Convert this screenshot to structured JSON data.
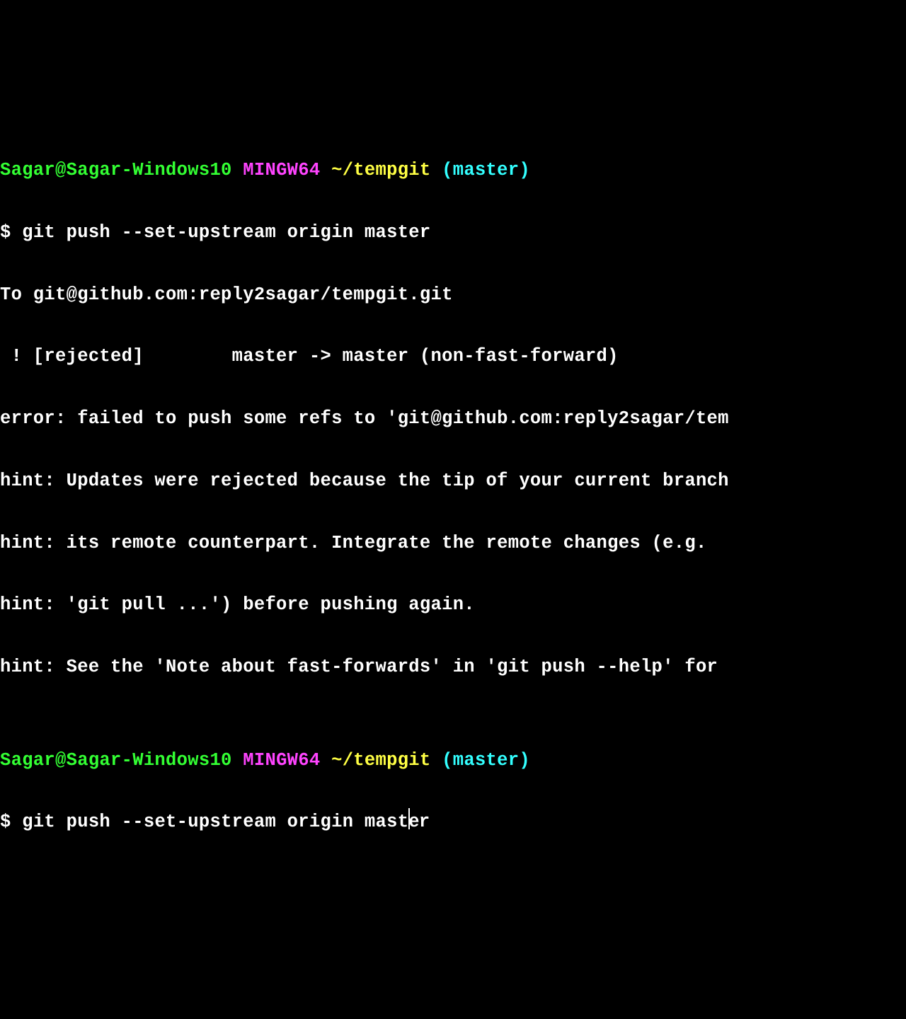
{
  "prompt1": {
    "user_host": "Sagar@Sagar-Windows10",
    "mingw": "MINGW64",
    "path": "~/tempgit",
    "branch": "(master)"
  },
  "cmd1_prefix": "$ ",
  "cmd1": "git push --set-upstream origin master",
  "out": {
    "l1": "To git@github.com:reply2sagar/tempgit.git",
    "l2": " ! [rejected]        master -> master (non-fast-forward)",
    "l3": "error: failed to push some refs to 'git@github.com:reply2sagar/tem",
    "l4": "hint: Updates were rejected because the tip of your current branch",
    "l5": "hint: its remote counterpart. Integrate the remote changes (e.g.",
    "l6": "hint: 'git pull ...') before pushing again.",
    "l7": "hint: See the 'Note about fast-forwards' in 'git push --help' for "
  },
  "blank": "",
  "prompt2": {
    "user_host": "Sagar@Sagar-Windows10",
    "mingw": "MINGW64",
    "path": "~/tempgit",
    "branch": "(master)"
  },
  "cmd2_prefix": "$ ",
  "cmd2_a": "git push --set-upstream origin maste",
  "cmd2_b": "r"
}
